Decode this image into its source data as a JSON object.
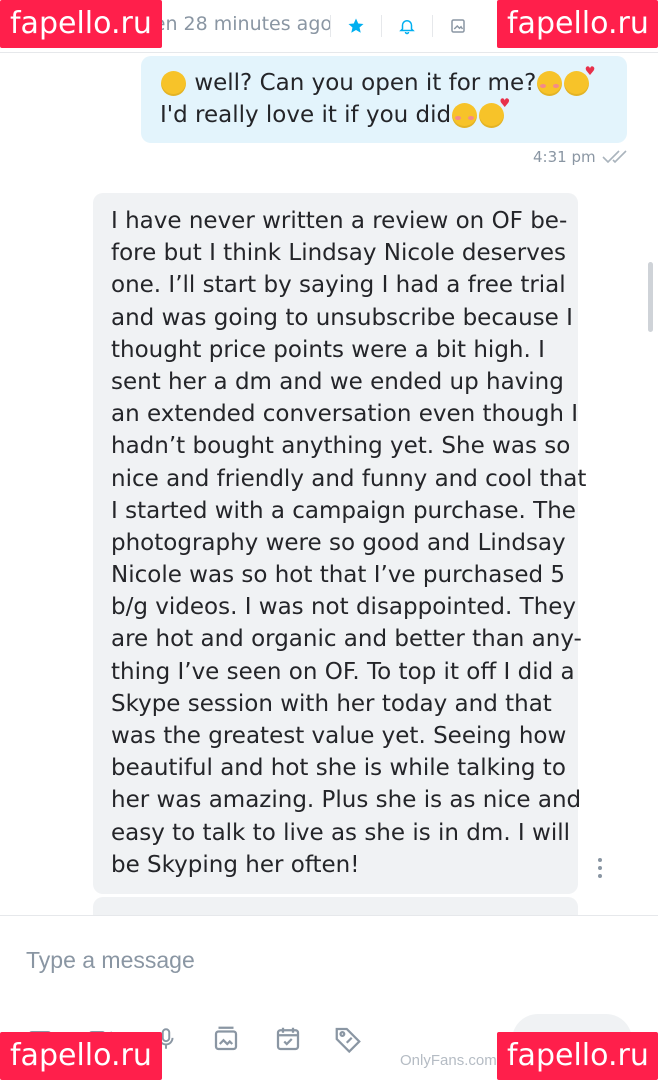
{
  "header": {
    "last_seen": "Seen 28 minutes ago",
    "icons": [
      "star-icon",
      "bell-icon",
      "image-icon"
    ]
  },
  "watermark": {
    "text": "fapello.ru"
  },
  "messages": {
    "outgoing": {
      "line1": "well? Can you open it for me?",
      "line2": "I'd really love it if you did",
      "time": "4:31 pm"
    },
    "incoming": {
      "lines": [
        "I have never written a review on OF be-",
        "fore but I think Lindsay Nicole deserves",
        "one. I’ll start by saying I had a free trial",
        "and was going to unsubscribe because I",
        "thought price points were a bit high. I",
        "sent her a dm and we ended up having",
        "an extended conversation even though I",
        "hadn’t bought anything yet. She was so",
        "nice and friendly and funny and cool that",
        "I started with a campaign purchase. The",
        "photography were so good and Lindsay",
        "Nicole was so hot that I’ve purchased 5",
        "b/g videos. I was not disappointed. They",
        "are hot and organic and better than any-",
        "thing I’ve seen on OF. To top it off I did a",
        "Skype session with her today and that",
        "was the greatest value yet. Seeing how",
        "beautiful and hot she is while talking to",
        "her was amazing. Plus she is as nice and",
        "easy to talk to live as she is in dm. I will",
        "be Skyping her often!"
      ]
    }
  },
  "composer": {
    "placeholder": "Type a message",
    "icons": [
      "camera-icon",
      "video-icon",
      "microphone-icon",
      "gallery-icon",
      "calendar-check-icon",
      "price-tag-icon"
    ],
    "brand_watermark": "OnlyFans.com"
  },
  "colors": {
    "accent": "#00aff0",
    "muted": "#8a96a3",
    "outgoing_bubble": "#e3f4fc",
    "incoming_bubble": "#f0f2f4",
    "watermark_bg": "#ff1f4b"
  }
}
